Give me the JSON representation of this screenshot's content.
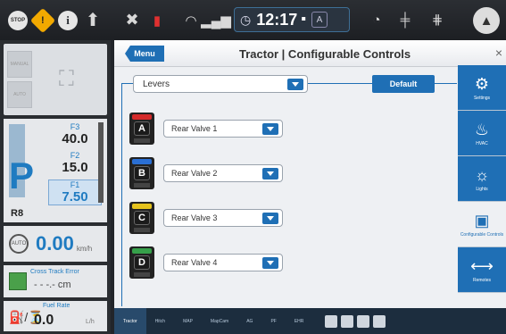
{
  "topbar": {
    "stop_label": "STOP",
    "info_label": "i",
    "time": "12:17",
    "clock_sub": "A"
  },
  "left": {
    "gears": [
      {
        "label": "F3",
        "value": "40.0"
      },
      {
        "label": "F2",
        "value": "15.0"
      },
      {
        "label": "F1",
        "value": "7.50"
      }
    ],
    "park_letter": "P",
    "reverse": "R8",
    "speed_value": "0.00",
    "speed_unit": "km/h",
    "cte_label": "Cross Track Error",
    "cte_value": "- - -.- cm",
    "fuel_label": "Fuel Rate",
    "fuel_value": "0.0",
    "fuel_unit": "L/h"
  },
  "header": {
    "menu": "Menu",
    "title": "Tractor | Configurable Controls",
    "close": "×"
  },
  "levers_dropdown": "Levers",
  "default_button": "Default",
  "levers": [
    {
      "letter": "A",
      "color": "#d42a2a",
      "value": "Rear Valve 1"
    },
    {
      "letter": "B",
      "color": "#2a6fd4",
      "value": "Rear Valve 2"
    },
    {
      "letter": "C",
      "color": "#e5c31e",
      "value": "Rear Valve 3"
    },
    {
      "letter": "D",
      "color": "#36a04a",
      "value": "Rear Valve 4"
    }
  ],
  "right_tabs": [
    {
      "icon": "tractor-settings-icon",
      "glyph": "⚙",
      "label": "Settings"
    },
    {
      "icon": "hvac-icon",
      "glyph": "♨",
      "label": "HVAC"
    },
    {
      "icon": "lights-icon",
      "glyph": "☼",
      "label": "Lights"
    },
    {
      "icon": "configurable-controls-icon",
      "glyph": "▣",
      "label": "Configurable Controls"
    },
    {
      "icon": "remotes-icon",
      "glyph": "⟷",
      "label": "Remotes"
    }
  ],
  "bottom_nav": [
    "Tractor",
    "Hitch",
    "MAP",
    "MapCam",
    "AG",
    "PF",
    "EHR"
  ]
}
